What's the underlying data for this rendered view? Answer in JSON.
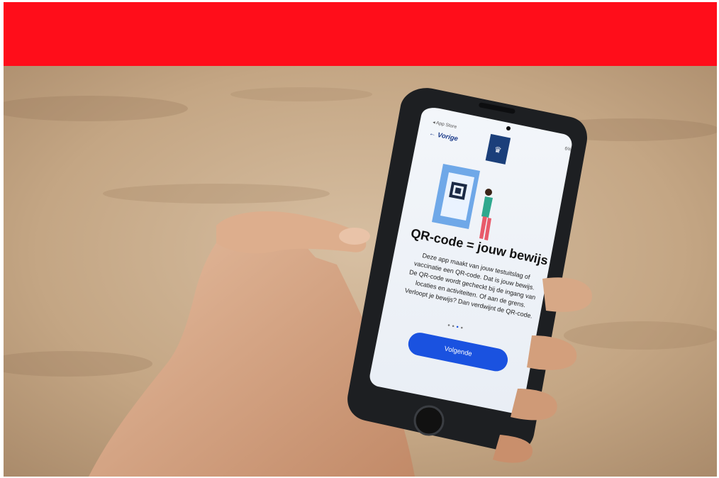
{
  "colors": {
    "banner": "#ff0d1a",
    "background": "#c8ab8a",
    "phone_case": "#1d1f22",
    "accent_button": "#1a52e0",
    "skin": "#d7a886"
  },
  "phone_screen": {
    "status_bar_left": "◂ App Store",
    "status_bar_right": "6%",
    "back_label": "← Vorige",
    "crest_icon": "coat-of-arms-icon",
    "illustration": "phone-with-qr-code-and-person-illustration",
    "title": "QR-code = jouw bewijs",
    "body_lines": [
      "Deze app maakt van jouw testuitslag of",
      "vaccinatie een QR-code. Dat is jouw bewijs.",
      "De QR-code wordt gecheckt bij de ingang van",
      "locaties en activiteiten. Of aan de grens.",
      "Verloopt je bewijs? Dan verdwijnt de QR-code."
    ],
    "pager": {
      "total": 4,
      "active": 3
    },
    "next_button": "Volgende"
  }
}
